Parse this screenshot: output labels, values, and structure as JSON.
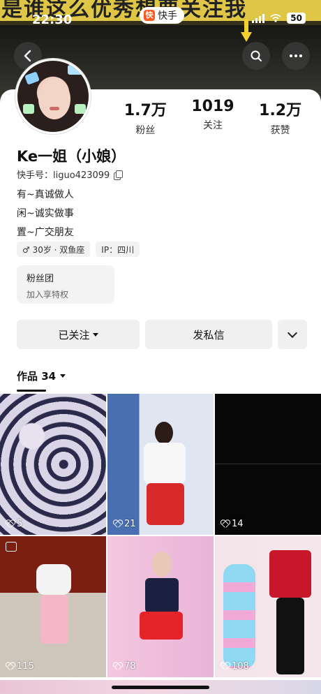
{
  "header": {
    "banner_text": "是谁这么优秀想要关注我",
    "status": {
      "time": "22:30",
      "battery": "50"
    },
    "app_badge": "快手",
    "logo_glyph": "快"
  },
  "profile": {
    "name": "Ke一姐（小娘）",
    "kwai_id": "快手号：liguo423099",
    "bio": [
      "有~真诚做人",
      "闲~诚实做事",
      "置~广交朋友"
    ],
    "tags": [
      "♂ 30岁 · 双鱼座",
      "IP：四川"
    ],
    "stats": [
      {
        "value": "1.7万",
        "label": "粉丝"
      },
      {
        "value": "1019",
        "label": "关注"
      },
      {
        "value": "1.2万",
        "label": "获赞"
      }
    ],
    "fanclub": {
      "title": "粉丝团",
      "subtitle": "加入享特权"
    }
  },
  "actions": {
    "follow_label": "已关注",
    "message_label": "发私信"
  },
  "works": {
    "tab_label": "作品 34",
    "items": [
      {
        "likes": "5"
      },
      {
        "likes": "21"
      },
      {
        "likes": "14"
      },
      {
        "likes": "115"
      },
      {
        "likes": "78"
      },
      {
        "likes": "108"
      }
    ]
  },
  "colors": {
    "accent_yellow": "#f4d22d",
    "brand_orange": "#ff5a1f"
  }
}
